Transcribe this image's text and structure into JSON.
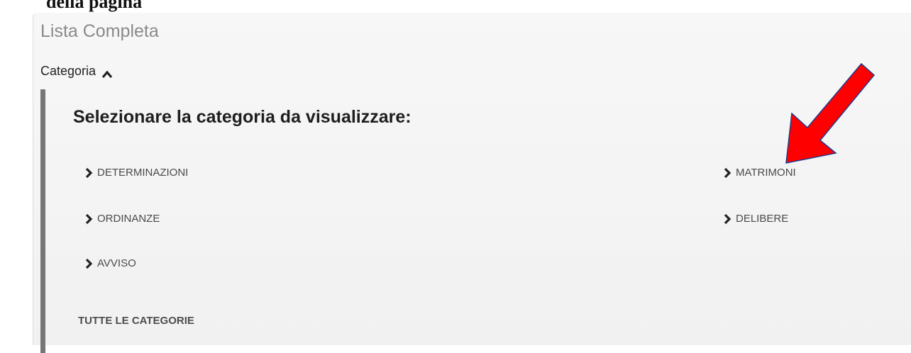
{
  "top_heading": "della pagina",
  "page_title": "Lista Completa",
  "category_toggle": {
    "label": "Categoria",
    "icon": "chevron-up-icon"
  },
  "section_heading": "Selezionare la categoria da visualizzare:",
  "categories": [
    {
      "label": "DETERMINAZIONI",
      "icon": "chevron-right-icon"
    },
    {
      "label": "MATRIMONI",
      "icon": "chevron-right-icon"
    },
    {
      "label": "ORDINANZE",
      "icon": "chevron-right-icon"
    },
    {
      "label": "DELIBERE",
      "icon": "chevron-right-icon"
    },
    {
      "label": "AVVISO",
      "icon": "chevron-right-icon"
    }
  ],
  "all_categories_link": "TUTTE LE CATEGORIE",
  "annotation": {
    "icon": "red-arrow-annotation",
    "color": "#ff0000",
    "outline_color": "#1f3a8a"
  }
}
